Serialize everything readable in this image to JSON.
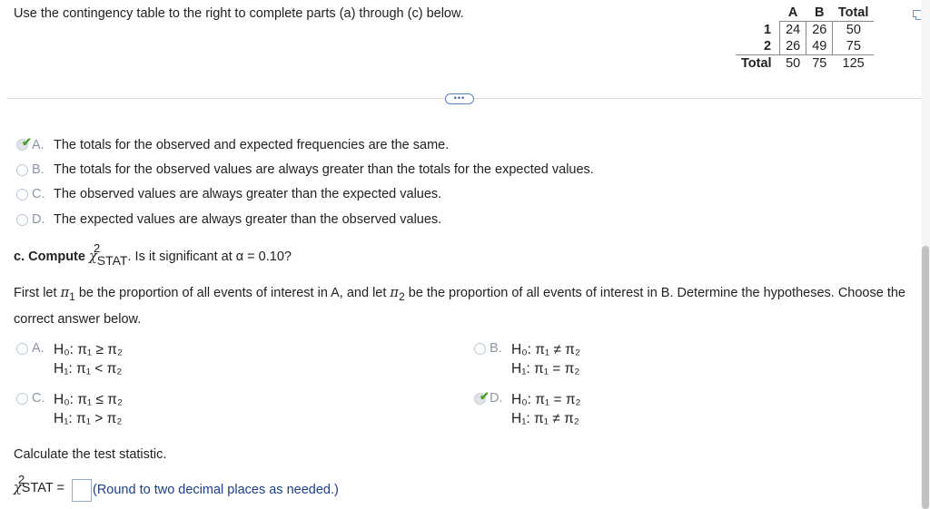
{
  "instructions": "Use the contingency table to the right to complete parts (a) through (c) below.",
  "table": {
    "headers": [
      "",
      "A",
      "B",
      "Total"
    ],
    "rows": [
      {
        "label": "1",
        "cells": [
          "24",
          "26",
          "50"
        ]
      },
      {
        "label": "2",
        "cells": [
          "26",
          "49",
          "75"
        ]
      },
      {
        "label": "Total",
        "cells": [
          "50",
          "75",
          "125"
        ]
      }
    ]
  },
  "expand_label": "•••",
  "part_b_options": [
    {
      "letter": "A.",
      "text": "The totals for the observed and expected frequencies are the same.",
      "selected": true
    },
    {
      "letter": "B.",
      "text": "The totals for the observed values are always greater than the totals for the expected values.",
      "selected": false
    },
    {
      "letter": "C.",
      "text": "The observed values are always greater than the expected values.",
      "selected": false
    },
    {
      "letter": "D.",
      "text": "The expected values are always greater than the observed values.",
      "selected": false
    }
  ],
  "part_c": {
    "prefix": "c. Compute",
    "chi": "χ",
    "sup": "2",
    "sub": "STAT",
    "suffix": ". Is it significant at α = 0.10?"
  },
  "first_let": {
    "t1": "First let ",
    "pi1": "π",
    "s1": "1",
    "t2": " be the proportion of all events of interest in A, and let ",
    "pi2": "π",
    "s2": "2",
    "t3": " be the proportion of all events of interest in B. Determine the hypotheses. Choose the correct answer below."
  },
  "hypothesis_options": [
    {
      "letter": "A.",
      "h0": "H₀: π₁ ≥ π₂",
      "h1": "H₁: π₁ < π₂",
      "selected": false
    },
    {
      "letter": "B.",
      "h0": "H₀: π₁ ≠ π₂",
      "h1": "H₁: π₁ = π₂",
      "selected": false
    },
    {
      "letter": "C.",
      "h0": "H₀: π₁ ≤ π₂",
      "h1": "H₁: π₁ > π₂",
      "selected": false
    },
    {
      "letter": "D.",
      "h0": "H₀: π₁ = π₂",
      "h1": "H₁: π₁ ≠ π₂",
      "selected": true
    }
  ],
  "calculate_label": "Calculate the test statistic.",
  "stat": {
    "chi": "χ",
    "sup": "2",
    "sub": "STAT",
    "eq": "=",
    "value": ""
  },
  "round_note": "(Round to two decimal places as needed.)",
  "colors": {
    "check": "#4a9e2c",
    "link_blue": "#1d3f8a",
    "radio_border": "#b9c5d6"
  }
}
